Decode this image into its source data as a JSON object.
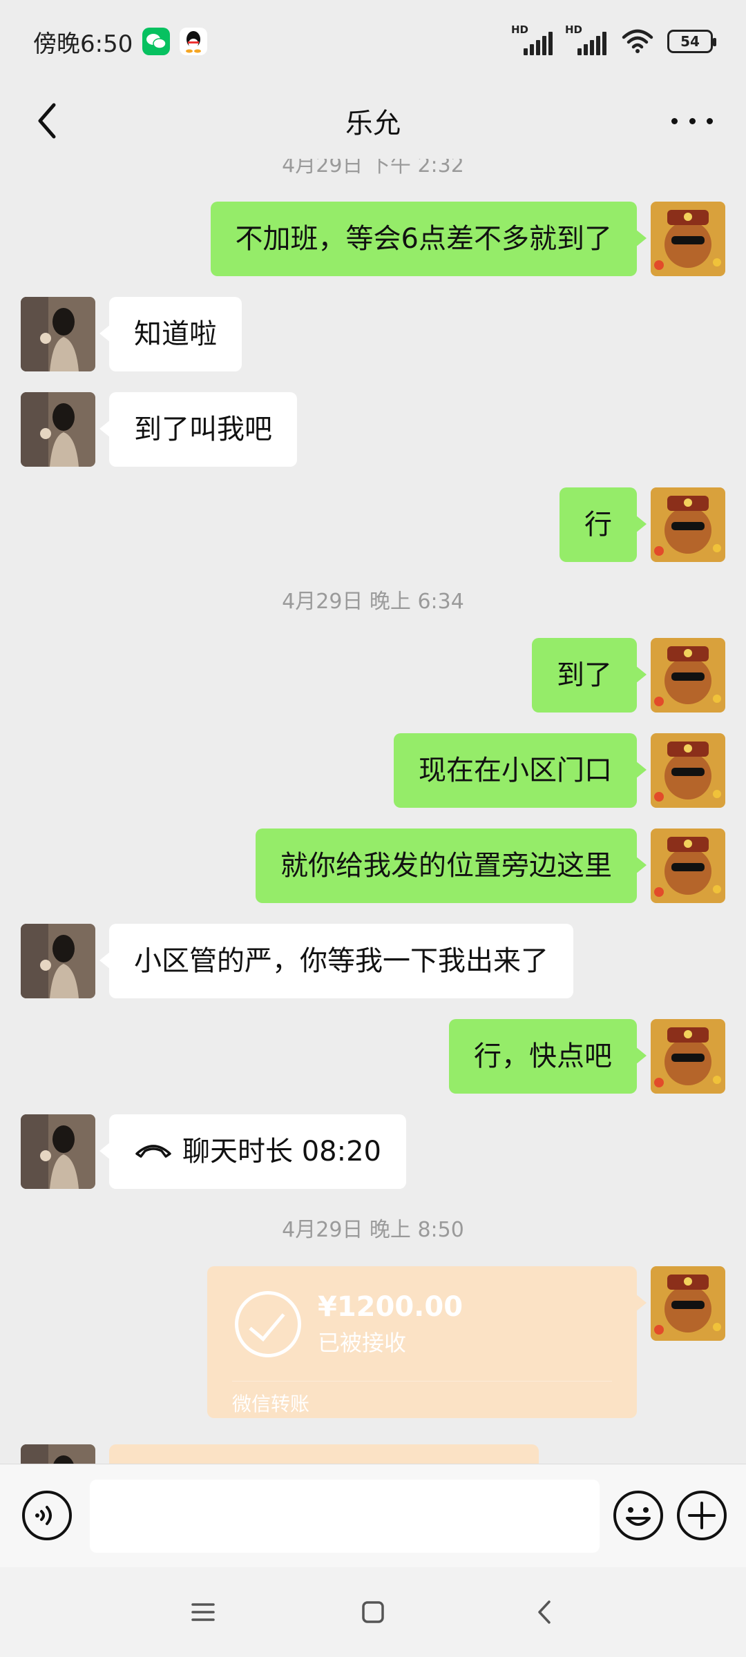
{
  "status_bar": {
    "time": "傍晚6:50",
    "hd1": "HD",
    "hd2": "HD",
    "battery": "54"
  },
  "header": {
    "title": "乐允"
  },
  "chat": {
    "timestamps": [
      "4月29日 下午 2:32",
      "4月29日 晚上 6:34",
      "4月29日 晚上 8:50"
    ],
    "messages": [
      {
        "from": "me",
        "text": "不加班，等会6点差不多就到了"
      },
      {
        "from": "them",
        "text": "知道啦"
      },
      {
        "from": "them",
        "text": "到了叫我吧"
      },
      {
        "from": "me",
        "text": "行"
      },
      {
        "from": "me",
        "text": "到了"
      },
      {
        "from": "me",
        "text": "现在在小区门口"
      },
      {
        "from": "me",
        "text": "就你给我发的位置旁边这里"
      },
      {
        "from": "them",
        "text": "小区管的严，你等我一下我出来了"
      },
      {
        "from": "me",
        "text": "行，快点吧"
      },
      {
        "from": "them",
        "text": "聊天时长 08:20"
      }
    ],
    "transfer": {
      "amount": "¥1200.00",
      "status": "已被接收",
      "label": "微信转账"
    }
  },
  "colors": {
    "me_bubble": "#95ec69",
    "them_bubble": "#ffffff",
    "transfer": "#fbe2c5",
    "background": "#ededed"
  }
}
